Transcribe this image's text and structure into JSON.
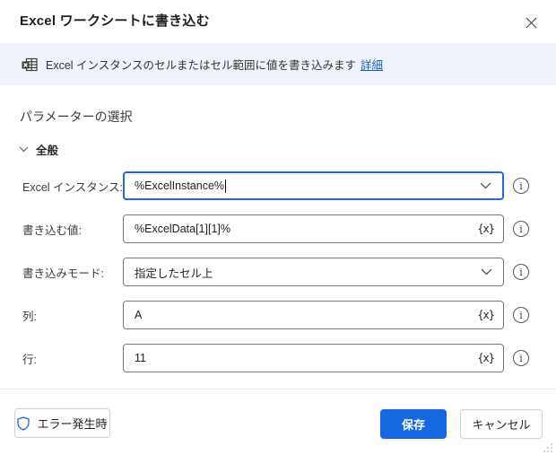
{
  "dialog": {
    "title": "Excel ワークシートに書き込む"
  },
  "description": {
    "text": "Excel インスタンスのセルまたはセル範囲に値を書き込みます",
    "link_label": "詳細",
    "icon": "excel-worksheet-icon"
  },
  "sections": {
    "params_header": "パラメーターの選択",
    "general_label": "全般"
  },
  "fields": [
    {
      "label": "Excel インスタンス:",
      "value": "%ExcelInstance%",
      "control": "combobox",
      "focused": true
    },
    {
      "label": "書き込む値:",
      "value": "%ExcelData[1][1]%",
      "control": "text",
      "fx": "{x}"
    },
    {
      "label": "書き込みモード:",
      "value": "指定したセル上",
      "control": "combobox"
    },
    {
      "label": "列:",
      "value": "A",
      "control": "text",
      "fx": "{x}"
    },
    {
      "label": "行:",
      "value": "11",
      "control": "text",
      "fx": "{x}"
    }
  ],
  "footer": {
    "on_error_label": "エラー発生時",
    "save_label": "保存",
    "cancel_label": "キャンセル"
  },
  "colors": {
    "brand_blue": "#1568df",
    "focus_border": "#2667dd",
    "strip_bg": "#eff4fb",
    "link_blue": "#155fc4"
  }
}
